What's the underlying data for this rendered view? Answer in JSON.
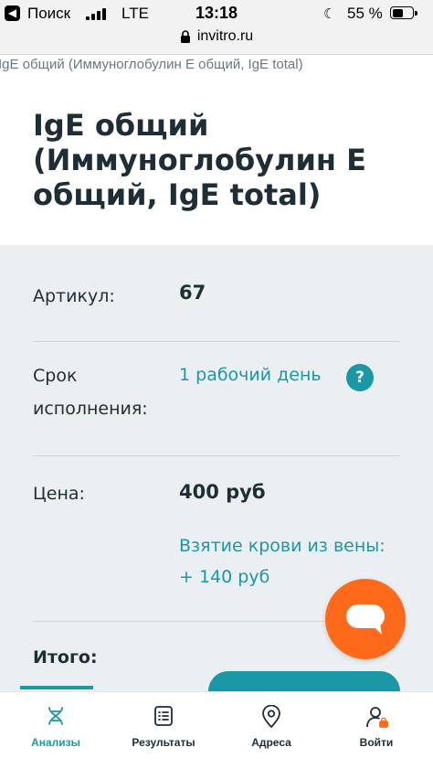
{
  "status_bar": {
    "carrier": "Поиск",
    "network": "LTE",
    "time": "13:18",
    "battery": "55 %",
    "battery_level": 0.55
  },
  "browser": {
    "url": "invitro.ru"
  },
  "breadcrumb": "IgE общий (Иммуноглобулин E общий, IgE total)",
  "page": {
    "title": "IgE общий (Иммуноглобулин E общий, IgE total)"
  },
  "info": {
    "article_label": "Артикул:",
    "article_value": "67",
    "term_label_line1": "Срок",
    "term_label_line2": "исполнения:",
    "term_value": "1 рабочий день",
    "help_glyph": "?",
    "price_label": "Цена:",
    "price_value": "400 руб",
    "blood_draw_line1": "Взятие крови из вены:",
    "blood_draw_line2": "+ 140 руб",
    "total_label": "Итого:"
  },
  "nav": {
    "items": [
      {
        "label": "Анализы",
        "icon": "dna-icon"
      },
      {
        "label": "Результаты",
        "icon": "list-icon"
      },
      {
        "label": "Адреса",
        "icon": "map-pin-icon"
      },
      {
        "label": "Войти",
        "icon": "user-lock-icon"
      }
    ]
  },
  "colors": {
    "accent": "#1a98a6",
    "chat": "#ff6a1a",
    "card_bg": "#ebeff1",
    "text": "#1f2d36"
  }
}
